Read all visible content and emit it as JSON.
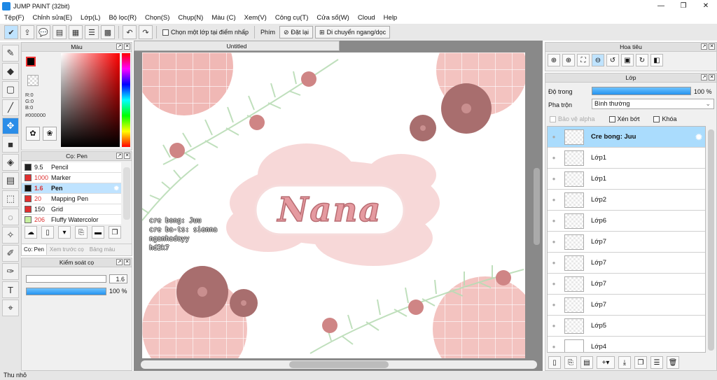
{
  "window": {
    "title": "JUMP PAINT (32bit)",
    "min": "—",
    "max": "❐",
    "close": "✕"
  },
  "menu": [
    "Tệp(F)",
    "Chỉnh sửa(E)",
    "Lớp(L)",
    "Bộ lọc(R)",
    "Chọn(S)",
    "Chụp(N)",
    "Màu (C)",
    "Xem(V)",
    "Công cụ(T)",
    "Cửa sổ(W)",
    "Cloud",
    "Help"
  ],
  "toolbar": {
    "select_layer_label": "Chọn một lớp tại điểm nhấp",
    "key_label": "Phím",
    "reset_label": "Đặt lại",
    "move_label": "Di chuyển ngang/dọc"
  },
  "color_panel": {
    "title": "Màu",
    "r": "R:0",
    "g": "G:0",
    "b": "B:0",
    "hex": "#000000",
    "current_color": "#000000"
  },
  "brush_panel": {
    "title": "Cọ: Pen",
    "brushes": [
      {
        "size": "9.5",
        "name": "Pencil",
        "color": "#222222"
      },
      {
        "size": "1000",
        "name": "Marker",
        "color": "#e03030"
      },
      {
        "size": "1.6",
        "name": "Pen",
        "color": "#111111"
      },
      {
        "size": "20",
        "name": "Mapping Pen",
        "color": "#e03030"
      },
      {
        "size": "150",
        "name": "Grid",
        "color": "#e03030"
      },
      {
        "size": "206",
        "name": "Fluffy Watercolor",
        "color": "#c8f0a0"
      }
    ],
    "tabs": [
      "Cọ: Pen",
      "Xem trước cọ",
      "Bảng màu"
    ]
  },
  "brush_control": {
    "title": "Kiểm soát cọ",
    "size": "1.6",
    "opacity": "100 %",
    "opacity_fraction": 1.0
  },
  "document": {
    "tab": "Untitled"
  },
  "artwork": {
    "lettering": "Nana",
    "credits": [
      "cre bong: Juu",
      "cre ba-ts: sienna",
      "nganhadayy",
      "hd2k7"
    ]
  },
  "navigator": {
    "title": "Hoa tiêu"
  },
  "layers": {
    "title": "Lớp",
    "opacity_label": "Độ trong",
    "opacity_value": "100 %",
    "opacity_fraction": 1.0,
    "blend_label": "Pha trộn",
    "blend_value": "Bình thường",
    "protect_alpha": "Bảo vệ alpha",
    "clip": "Xén bớt",
    "lock": "Khóa",
    "items": [
      "Cre bong: Juu",
      "Lớp1",
      "Lớp1",
      "Lớp2",
      "Lớp6",
      "Lớp7",
      "Lớp7",
      "Lớp7",
      "Lớp7",
      "Lớp5",
      "Lớp4"
    ]
  },
  "status": {
    "text": "Thu nhỏ"
  }
}
